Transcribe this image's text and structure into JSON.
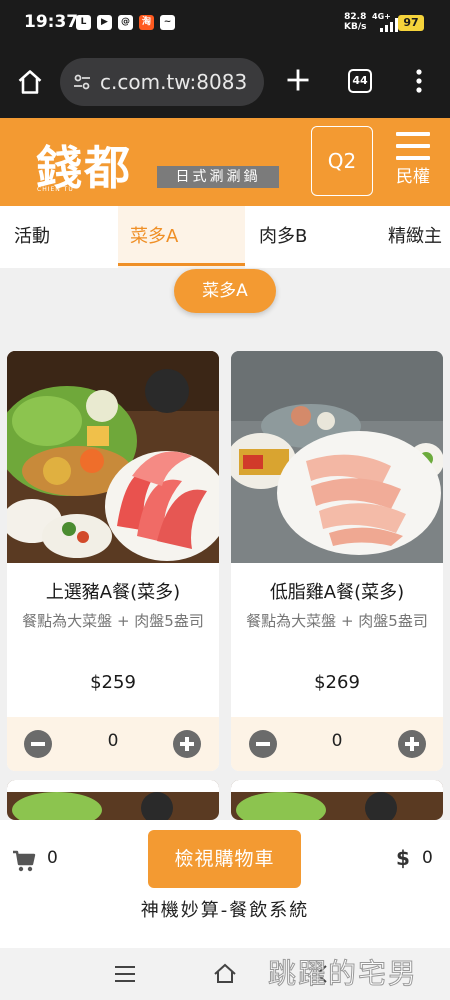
{
  "status_bar": {
    "time": "19:37",
    "net_speed_value": "82.8",
    "net_speed_unit": "KB/s",
    "network": "4G+",
    "battery": "97",
    "notification_icons": [
      "line-icon",
      "play-icon",
      "threads-icon",
      "taobao-icon",
      "messenger-icon"
    ]
  },
  "browser": {
    "url": "c.com.tw:8083",
    "tab_count": "44"
  },
  "header": {
    "logo_text": "錢都",
    "logo_subtext": "CHIEN TU",
    "logo_tag": "日式涮涮鍋",
    "table_number": "Q2",
    "menu_label": "民權",
    "brand_color": "#f39a32"
  },
  "categories": [
    {
      "label": "活動",
      "active": false
    },
    {
      "label": "菜多A",
      "active": true
    },
    {
      "label": "肉多B",
      "active": false
    },
    {
      "label": "精緻主",
      "active": false
    }
  ],
  "section_pill": "菜多A",
  "products": [
    {
      "name": "上選豬A餐(菜多)",
      "desc": "餐點為大菜盤 + 肉盤5盎司",
      "price": "$259",
      "qty": "0"
    },
    {
      "name": "低脂雞A餐(菜多)",
      "desc": "餐點為大菜盤 + 肉盤5盎司",
      "price": "$269",
      "qty": "0"
    }
  ],
  "cart": {
    "count": "0",
    "button_label": "檢視購物車",
    "total": "0",
    "footer": "神機妙算-餐飲系統"
  },
  "watermark": "跳躍的宅男"
}
